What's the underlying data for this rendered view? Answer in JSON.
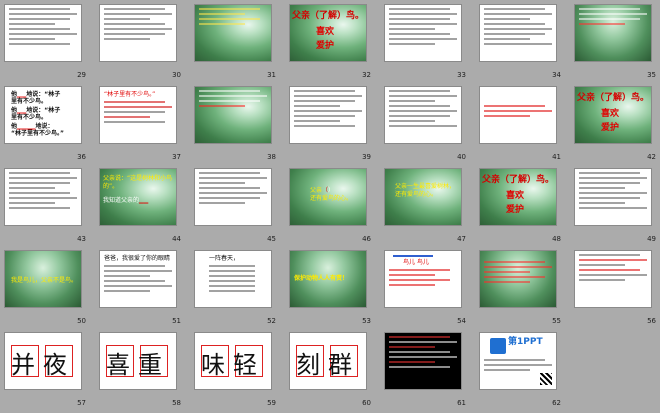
{
  "slides": [
    {
      "num": "29",
      "kind": "text-white"
    },
    {
      "num": "30",
      "kind": "text-white"
    },
    {
      "num": "31",
      "kind": "forest-text",
      "lines": [
        "",
        "",
        ""
      ]
    },
    {
      "num": "32",
      "kind": "title",
      "title": "父亲（了解）鸟。",
      "sub1": "喜欢",
      "sub2": "爱护"
    },
    {
      "num": "33",
      "kind": "text-white"
    },
    {
      "num": "34",
      "kind": "text-white"
    },
    {
      "num": "35",
      "kind": "forest-text"
    },
    {
      "num": "36",
      "kind": "poem",
      "l1": "他",
      "l2": "里有不少鸟。",
      "l3": "他",
      "l4": "里有不少鸟。",
      "l5": "他",
      "l6": "“林子里有不少鸟。”"
    },
    {
      "num": "37",
      "kind": "text-white",
      "head": "“林子里有不少鸟。”"
    },
    {
      "num": "38",
      "kind": "forest-text"
    },
    {
      "num": "39",
      "kind": "text-white"
    },
    {
      "num": "40",
      "kind": "text-white"
    },
    {
      "num": "41",
      "kind": "text-white"
    },
    {
      "num": "42",
      "kind": "title",
      "title": "父亲（了解）鸟。",
      "sub1": "喜欢",
      "sub2": "爱护"
    },
    {
      "num": "43",
      "kind": "text-white"
    },
    {
      "num": "44",
      "kind": "forest-text",
      "y1": "父亲说：",
      "y2": "“这是树林和小鸟",
      "y3": "的”。",
      "w1": "我知道父亲的"
    },
    {
      "num": "45",
      "kind": "text-white"
    },
    {
      "num": "46",
      "kind": "forest-text",
      "y1": "父亲",
      "r1": "（",
      "w1": "）",
      "y2": "还有爱鸟的心。"
    },
    {
      "num": "47",
      "kind": "forest-text",
      "y1": "父亲一生最喜爱树林，",
      "y2": "还有爱鸟的心。"
    },
    {
      "num": "48",
      "kind": "title",
      "title": "父亲（了解）鸟。",
      "sub1": "喜欢",
      "sub2": "爱护"
    },
    {
      "num": "49",
      "kind": "text-white"
    },
    {
      "num": "50",
      "kind": "forest-text",
      "y1": "我是鸟儿，父亲不是鸟。"
    },
    {
      "num": "51",
      "kind": "text-white",
      "head": "爸爸，我很爱了你的眼睛"
    },
    {
      "num": "52",
      "kind": "text-white",
      "head": "一阵春天，"
    },
    {
      "num": "53",
      "kind": "forest-text",
      "y1": "保护动物人人有责！"
    },
    {
      "num": "54",
      "kind": "text-white",
      "head": "鸟儿 鸟儿"
    },
    {
      "num": "55",
      "kind": "forest-text"
    },
    {
      "num": "56",
      "kind": "text-white"
    },
    {
      "num": "57",
      "kind": "chars",
      "text": "并夜"
    },
    {
      "num": "58",
      "kind": "chars",
      "text": "喜重"
    },
    {
      "num": "59",
      "kind": "chars",
      "text": "味轻"
    },
    {
      "num": "60",
      "kind": "chars",
      "text": "刻群"
    },
    {
      "num": "61",
      "kind": "black"
    },
    {
      "num": "62",
      "kind": "ppt",
      "logo": "第1PPT"
    }
  ]
}
